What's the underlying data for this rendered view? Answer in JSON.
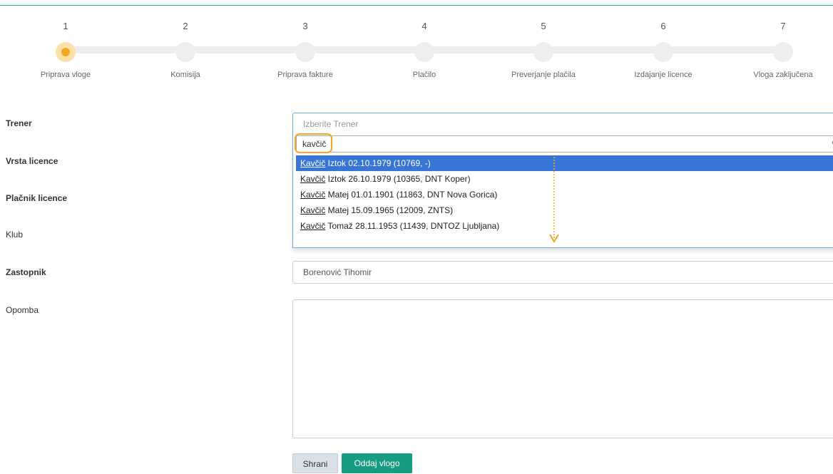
{
  "stepper": {
    "steps": [
      {
        "number": "1",
        "label": "Priprava vloge",
        "active": true
      },
      {
        "number": "2",
        "label": "Komisija",
        "active": false
      },
      {
        "number": "3",
        "label": "Priprava fakture",
        "active": false
      },
      {
        "number": "4",
        "label": "Plačilo",
        "active": false
      },
      {
        "number": "5",
        "label": "Preverjanje plačila",
        "active": false
      },
      {
        "number": "6",
        "label": "Izdajanje licence",
        "active": false
      },
      {
        "number": "7",
        "label": "Vloga zaključena",
        "active": false
      }
    ],
    "active_color": "#f5a623"
  },
  "form": {
    "trener": {
      "label": "Trener",
      "placeholder": "Izberite Trener",
      "search_value": "kavčič",
      "results": [
        {
          "match": "Kavčič",
          "rest": " Iztok 02.10.1979 (10769, -)",
          "selected": true
        },
        {
          "match": "Kavčič",
          "rest": " Iztok 26.10.1979 (10365, DNT Koper)",
          "selected": false
        },
        {
          "match": "Kavčič",
          "rest": " Matej 01.01.1901 (11863, DNT Nova Gorica)",
          "selected": false
        },
        {
          "match": "Kavčič",
          "rest": " Matej 15.09.1965 (12009, ZNTS)",
          "selected": false
        },
        {
          "match": "Kavčič",
          "rest": " Tomaž 28.11.1953 (11439, DNTOZ Ljubljana)",
          "selected": false
        }
      ]
    },
    "vrsta_licence": {
      "label": "Vrsta licence"
    },
    "placnik_licence": {
      "label": "Plačnik licence"
    },
    "klub": {
      "label": "Klub"
    },
    "zastopnik": {
      "label": "Zastopnik",
      "value": "Borenović Tihomir"
    },
    "opomba": {
      "label": "Opomba",
      "value": ""
    }
  },
  "buttons": {
    "save": "Shrani",
    "submit": "Oddaj vlogo"
  },
  "colors": {
    "accent_teal": "#179c82",
    "selected_blue": "#3875d7",
    "annotation_orange": "#f5a623"
  }
}
